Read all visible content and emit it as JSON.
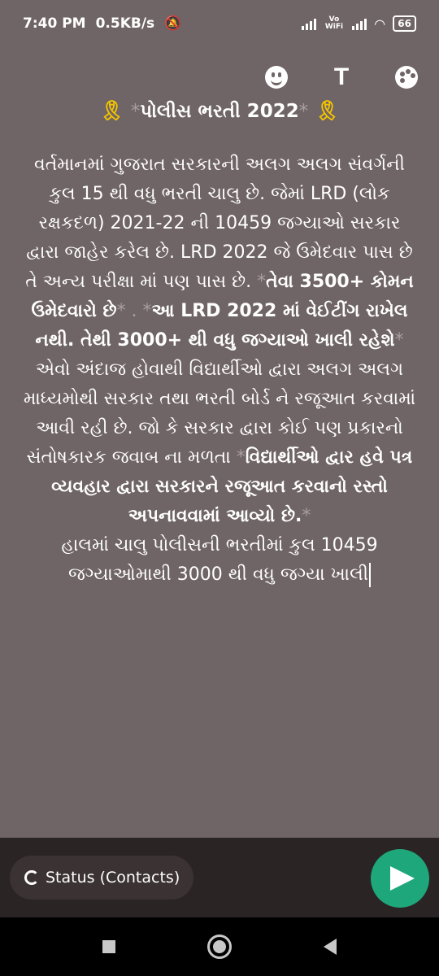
{
  "status_bar": {
    "time": "7:40 PM",
    "speed": "0.5KB/s",
    "vowifi": "Vo WiFi",
    "battery": "66"
  },
  "toolbar": {
    "emoji_icon": "smiley-icon",
    "text_label": "T",
    "palette_icon": "palette-icon"
  },
  "message": {
    "title_mark_open": "*",
    "title": "પોલીસ ભરતી 2022",
    "title_mark_close": "*",
    "para1_a": "વર્તમાનમાં ગુજરાત સરકારની અલગ અલગ સંવર્ગની કુલ 15 થી વધુ ભરતી ચાલુ છે. જેમાં LRD (લોક રક્ષકદળ) 2021-22 ની 10459 જગ્યાઓ સરકાર દ્વારા જાહેર કરેલ છે. LRD 2022 જે ઉમેદવાર પાસ છે તે અન્ય પરીક્ષા માં પણ પાસ છે.",
    "mark1": "*",
    "bold1": "તેવા 3500+ કોમન ઉમેદવારો છે",
    "mark2": "* . *",
    "bold2": "આ LRD 2022 માં વેઈટીંગ રાખેલ નથી. તેથી 3000+ થી વધુ જગ્યાઓ ખાલી રહેશે",
    "mark3": "*",
    "para1_b": "એવો અંદાજ હોવાથી  વિદ્યાર્થીઓ દ્વારા અલગ અલગ માધ્યમોથી સરકાર તથા ભરતી બોર્ડ ને રજૂઆત કરવામાં આવી રહી છે. જો કે સરકાર દ્વારા કોઈ પણ પ્રકારનો સંતોષકારક જવાબ ના મળતા",
    "mark4": "*",
    "bold3": "વિદ્યાર્થીઓ દ્વાર હવે પત્ર વ્યવહાર દ્વારા સરકારને રજૂઆત કરવાનો રસ્તો અપનાવવામાં આવ્યો છે.",
    "mark5": "*",
    "para2": "હાલમાં ચાલુ પોલીસની ભરતીમાં કુલ 10459 જગ્યાઓમાથી 3000 થી વધુ જગ્યા ખાલી"
  },
  "bottom": {
    "status_chip": "Status (Contacts)"
  },
  "colors": {
    "background": "#6f6466",
    "send": "#1ea77a",
    "ribbon": "#f4c400"
  }
}
